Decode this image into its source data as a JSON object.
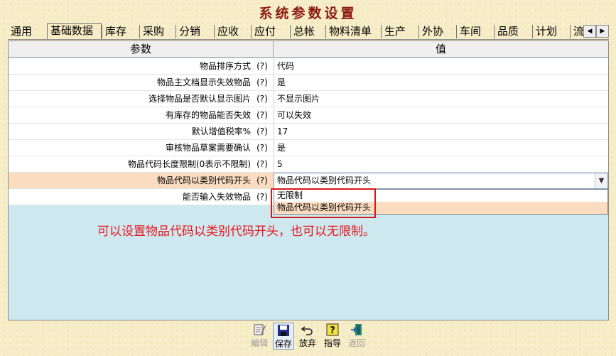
{
  "window": {
    "title": "系统参数设置"
  },
  "tabs": [
    {
      "label": "通用",
      "active": false
    },
    {
      "label": "基础数据",
      "active": true
    },
    {
      "label": "库存",
      "active": false
    },
    {
      "label": "采购",
      "active": false
    },
    {
      "label": "分销",
      "active": false
    },
    {
      "label": "应收",
      "active": false
    },
    {
      "label": "应付",
      "active": false
    },
    {
      "label": "总帐",
      "active": false
    },
    {
      "label": "物料清单",
      "active": false
    },
    {
      "label": "生产",
      "active": false
    },
    {
      "label": "外协",
      "active": false
    },
    {
      "label": "车间",
      "active": false
    },
    {
      "label": "品质",
      "active": false
    },
    {
      "label": "计划",
      "active": false
    },
    {
      "label": "流",
      "active": false
    }
  ],
  "tab_scroll": {
    "left_icon": "triangle-left-icon",
    "right_icon": "triangle-right-icon"
  },
  "grid": {
    "header_param": "参数",
    "header_value": "值",
    "rows": [
      {
        "label": "物品排序方式",
        "help": "(?)",
        "value": "代码"
      },
      {
        "label": "物品主文档显示失效物品",
        "help": "(?)",
        "value": "是"
      },
      {
        "label": "选择物品是否默认显示图片",
        "help": "(?)",
        "value": "不显示图片"
      },
      {
        "label": "有库存的物品能否失效",
        "help": "(?)",
        "value": "可以失效"
      },
      {
        "label": "默认增值税率%",
        "help": "(?)",
        "value": "17"
      },
      {
        "label": "审核物品草案需要确认",
        "help": "(?)",
        "value": "是"
      },
      {
        "label": "物品代码长度限制(0表示不限制)",
        "help": "(?)",
        "value": "5"
      },
      {
        "label": "物品代码以类别代码开头",
        "help": "(?)",
        "value": "物品代码以类别代码开头",
        "selected": true
      },
      {
        "label": "能否输入失效物品",
        "help": "(?)",
        "value": ""
      }
    ],
    "dropdown_options": [
      "无限制",
      "物品代码以类别代码开头"
    ],
    "dropdown_highlight": 1
  },
  "annotation": "可以设置物品代码以类别代码开头，也可以无限制。",
  "toolbar": {
    "edit_label": "编辑",
    "save_label": "保存",
    "discard_label": "放弃",
    "guide_label": "指导",
    "back_label": "返回"
  },
  "colors": {
    "title": "#8b1a10",
    "selected_row": "#fbdcc0",
    "annotation": "#e8161b",
    "grid_body": "#cde8ef"
  }
}
